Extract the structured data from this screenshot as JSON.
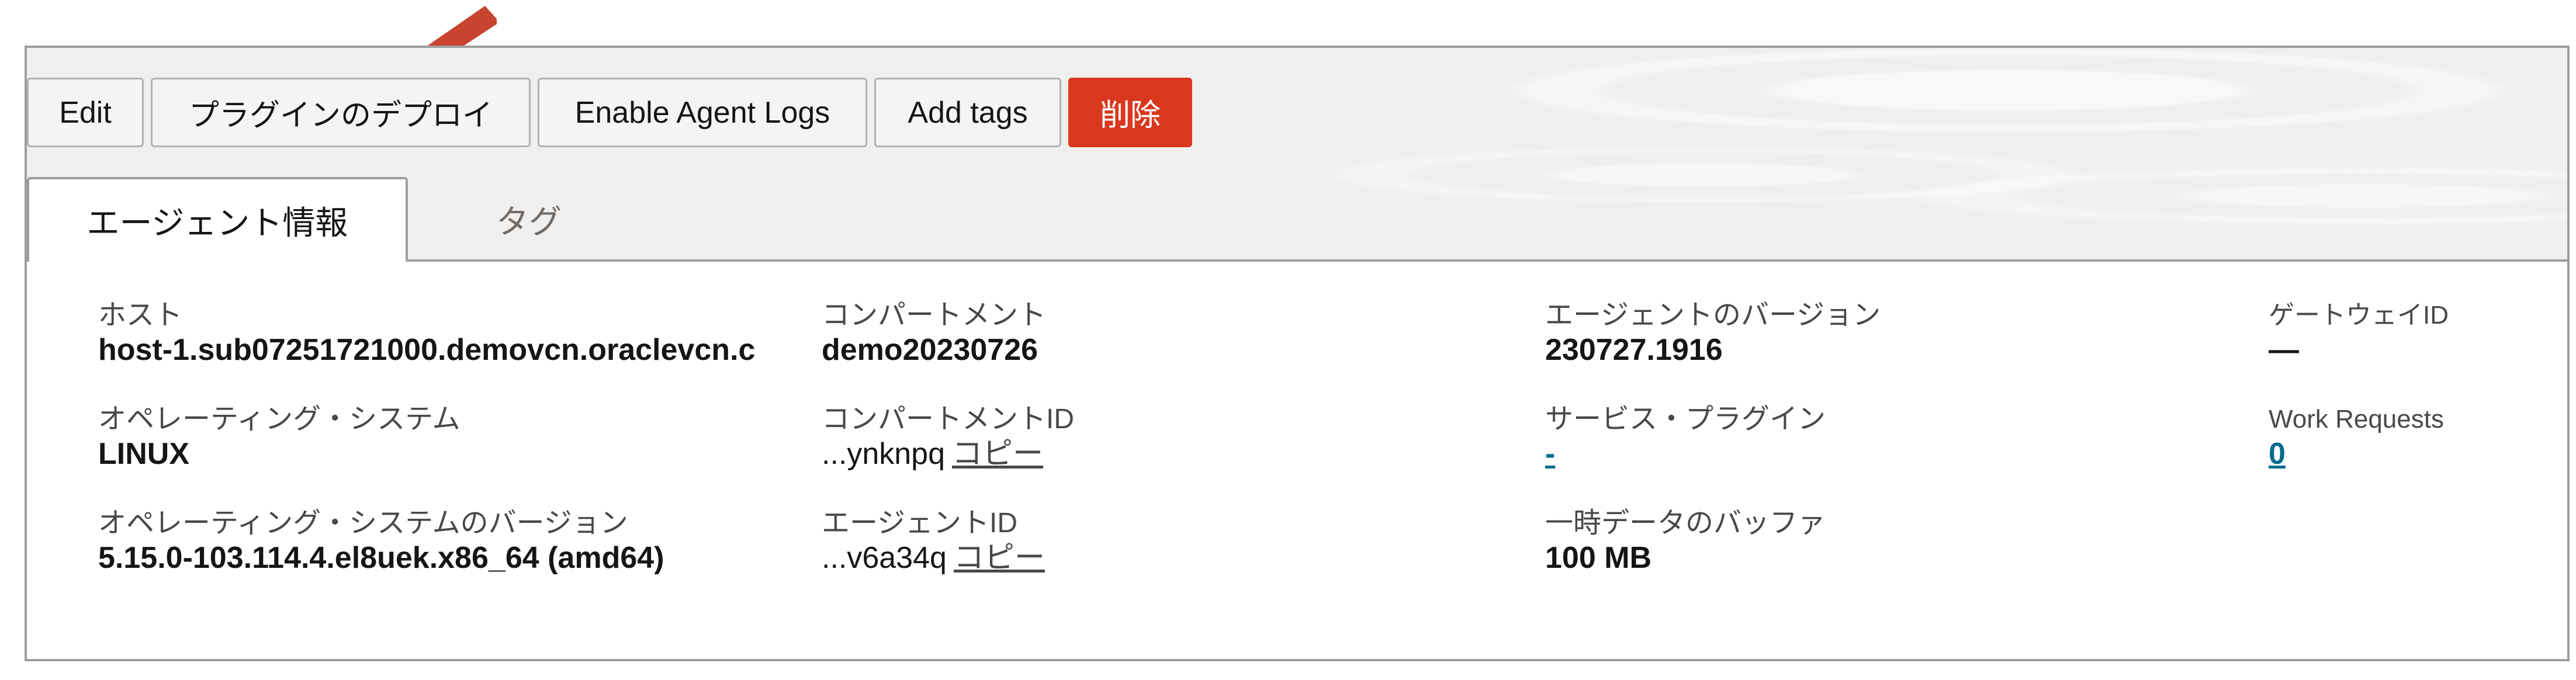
{
  "toolbar": {
    "edit": "Edit",
    "deploy_plugins": "プラグインのデプロイ",
    "enable_agent_logs": "Enable Agent Logs",
    "add_tags": "Add tags",
    "delete": "削除"
  },
  "tabs": {
    "agent_info": "エージェント情報",
    "tags": "タグ"
  },
  "details": {
    "host_label": "ホスト",
    "host_value": "host-1.sub07251721000.demovcn.oraclevcn.c",
    "os_label": "オペレーティング・システム",
    "os_value": "LINUX",
    "os_version_label": "オペレーティング・システムのバージョン",
    "os_version_value": "5.15.0-103.114.4.el8uek.x86_64 (amd64)",
    "compartment_label": "コンパートメント",
    "compartment_value": "demo20230726",
    "compartment_id_label": "コンパートメントID",
    "compartment_id_value": "...ynknpq",
    "agent_id_label": "エージェントID",
    "agent_id_value": "...v6a34q",
    "copy_label": "コピー",
    "agent_version_label": "エージェントのバージョン",
    "agent_version_value": "230727.1916",
    "service_plugin_label": "サービス・プラグイン",
    "service_plugin_value": "-",
    "buffer_label": "一時データのバッファ",
    "buffer_value": "100 MB",
    "gateway_id_label": "ゲートウェイID",
    "gateway_id_value": "—",
    "work_requests_label": "Work Requests",
    "work_requests_value": "0"
  },
  "colors": {
    "danger": "#d9381e",
    "arrow": "#c8442f",
    "link": "#006b8f"
  }
}
